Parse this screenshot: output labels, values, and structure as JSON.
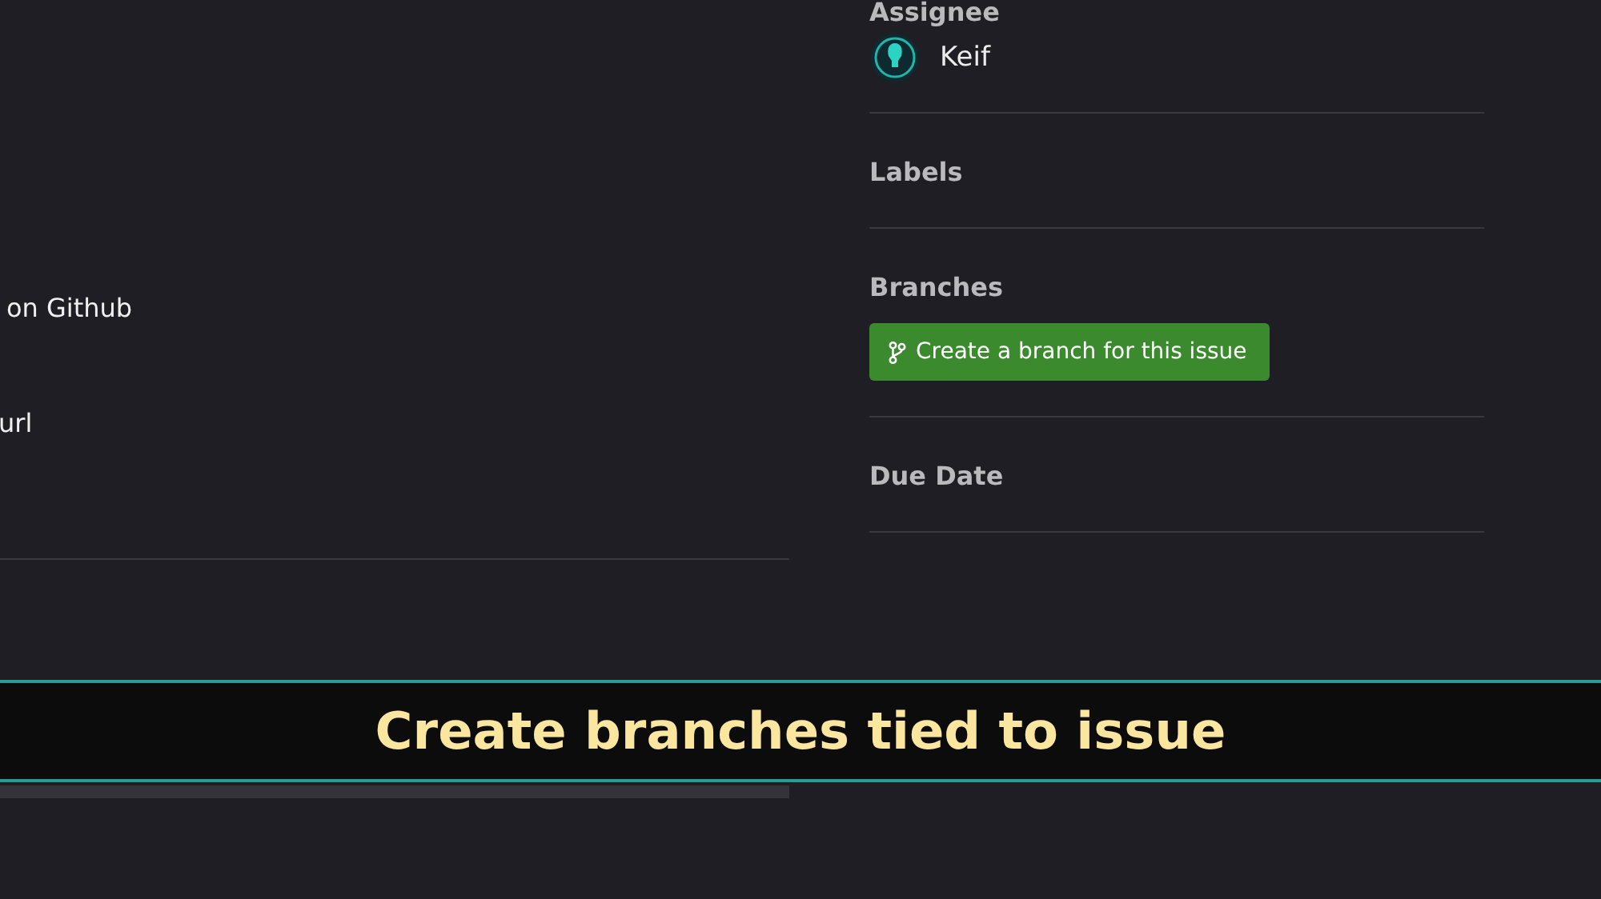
{
  "description": {
    "lines": [
      "on Github",
      "url"
    ]
  },
  "sidebar": {
    "assignee": {
      "heading": "Assignee",
      "name": "Keif"
    },
    "labels": {
      "heading": "Labels"
    },
    "branches": {
      "heading": "Branches",
      "button": "Create a branch for this issue"
    },
    "due_date": {
      "heading": "Due Date"
    }
  },
  "caption": "Create branches tied to issue"
}
